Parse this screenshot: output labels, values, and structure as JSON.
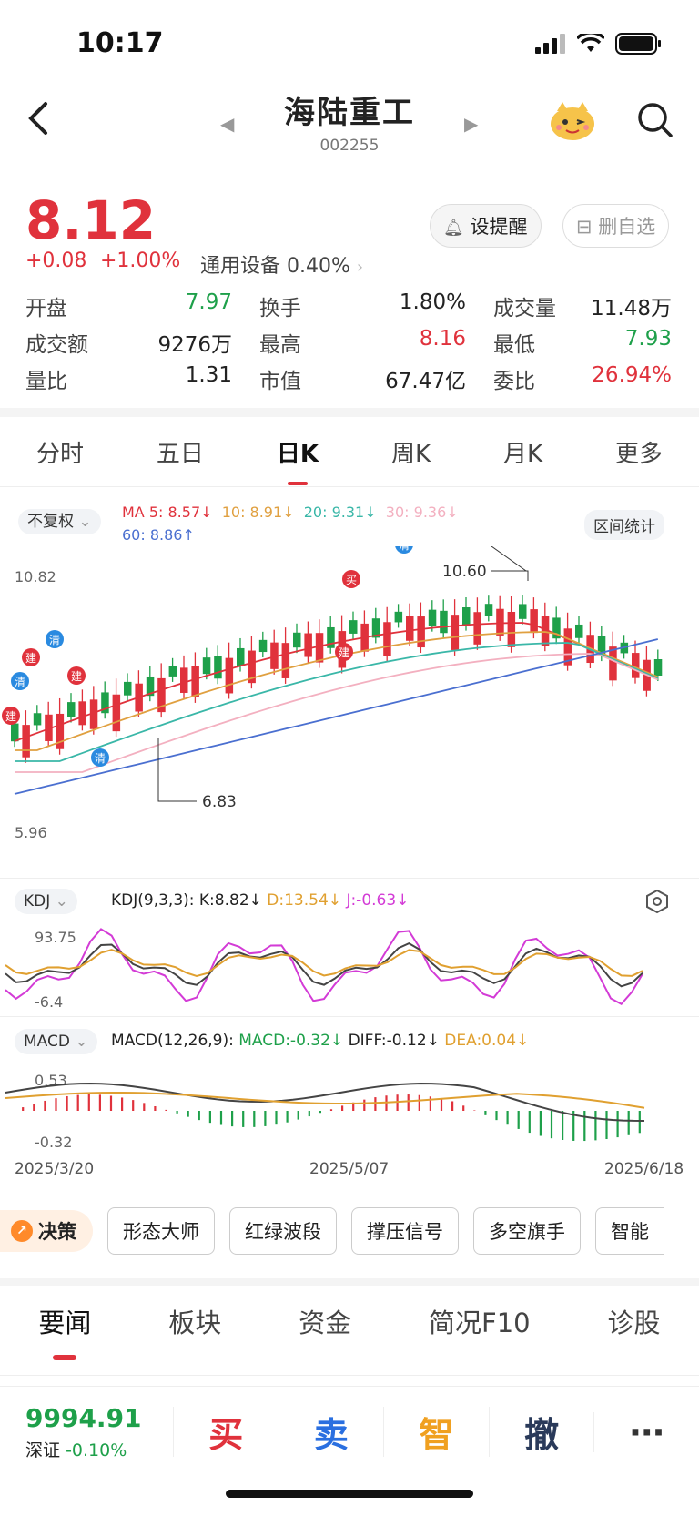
{
  "status": {
    "time": "10:17"
  },
  "nav": {
    "title": "海陆重工",
    "code": "002255"
  },
  "quote": {
    "price": "8.12",
    "change": "+0.08",
    "change_pct": "+1.00%",
    "sector": "通用设备",
    "sector_pct": "0.40%"
  },
  "actions": {
    "alert": "设提醒",
    "remove_watch": "删自选"
  },
  "stats": [
    [
      {
        "label": "开盘",
        "value": "7.97",
        "color": "green"
      },
      {
        "label": "换手",
        "value": "1.80%",
        "color": "blk"
      },
      {
        "label": "成交量",
        "value": "11.48万",
        "color": "blk"
      }
    ],
    [
      {
        "label": "成交额",
        "value": "9276万",
        "color": "blk"
      },
      {
        "label": "最高",
        "value": "8.16",
        "color": "red"
      },
      {
        "label": "最低",
        "value": "7.93",
        "color": "green"
      }
    ],
    [
      {
        "label": "量比",
        "value": "1.31",
        "color": "blk"
      },
      {
        "label": "市值",
        "value": "67.47亿",
        "color": "blk"
      },
      {
        "label": "委比",
        "value": "26.94%",
        "color": "red"
      }
    ]
  ],
  "chart_tabs": [
    "分时",
    "五日",
    "日K",
    "周K",
    "月K",
    "更多"
  ],
  "active_chart_tab": "日K",
  "ma": {
    "adjust": "不复权",
    "ma5": "MA 5: 8.57↓",
    "ma10": "10: 8.91↓",
    "ma20": "20: 9.31↓",
    "ma30": "30: 9.36↓",
    "ma60": "60: 8.86↑",
    "range_stats": "区间统计"
  },
  "kline": {
    "top_label": "10.82",
    "bottom_label": "5.96",
    "high_label": "10.60",
    "low_label": "6.83",
    "colors": {
      "up": "#e0323c",
      "down": "#1ea04a",
      "ma5": "#e0323c",
      "ma10": "#e0a040",
      "ma20": "#3ab7a8",
      "ma30": "#f3b0c0",
      "ma60": "#4a6fd0"
    }
  },
  "kdj": {
    "label": "KDJ",
    "params": "KDJ(9,3,3):",
    "k": "K:8.82↓",
    "d": "D:13.54↓",
    "j": "J:-0.63↓",
    "top": "93.75",
    "bottom": "-6.4"
  },
  "macd": {
    "label": "MACD",
    "params": "MACD(12,26,9):",
    "macd": "MACD:-0.32↓",
    "diff": "DIFF:-0.12↓",
    "dea": "DEA:0.04↓",
    "top": "0.53",
    "bottom": "-0.32"
  },
  "dates": [
    "2025/3/20",
    "2025/5/07",
    "2025/6/18"
  ],
  "chips": {
    "decision": "决策",
    "items": [
      "形态大师",
      "红绿波段",
      "撑压信号",
      "多空旗手",
      "智能"
    ]
  },
  "bottom_tabs": [
    "要闻",
    "板块",
    "资金",
    "简况F10",
    "诊股"
  ],
  "index": {
    "value": "9994.91",
    "name": "深证",
    "pct": "-0.10%"
  },
  "toolbar": {
    "buy": "买",
    "sell": "卖",
    "smart": "智",
    "cancel": "撤",
    "more": "⋯"
  }
}
